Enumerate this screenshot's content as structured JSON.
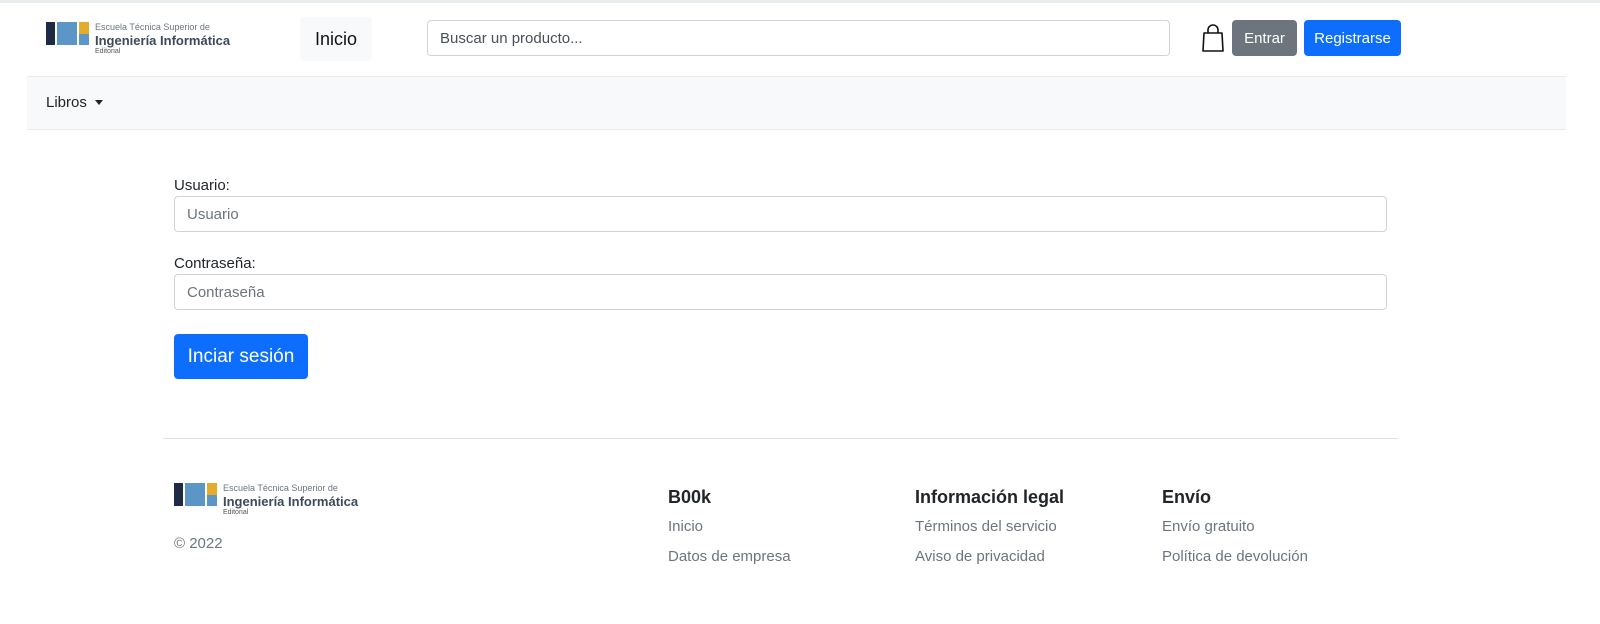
{
  "header": {
    "logo": {
      "line1": "Escuela Técnica Superior de",
      "line2": "Ingeniería Informática",
      "line3": "Editorial"
    },
    "home_link": "Inicio",
    "search_placeholder": "Buscar un producto...",
    "cart_icon": "shopping-bag-icon",
    "login_label": "Entrar",
    "register_label": "Registrarse"
  },
  "nav": {
    "books_dropdown": "Libros"
  },
  "form": {
    "user_label": "Usuario:",
    "user_placeholder": "Usuario",
    "password_label": "Contraseña:",
    "password_placeholder": "Contraseña",
    "submit_label": "Inciar sesión"
  },
  "footer": {
    "logo": {
      "line1": "Escuela Técnica Superior de",
      "line2": "Ingeniería Informática",
      "line3": "Editorial"
    },
    "copyright": "© 2022",
    "columns": [
      {
        "title": "B00k",
        "links": [
          "Inicio",
          "Datos de empresa"
        ]
      },
      {
        "title": "Información legal",
        "links": [
          "Términos del servicio",
          "Aviso de privacidad"
        ]
      },
      {
        "title": "Envío",
        "links": [
          "Envío gratuito",
          "Política de devolución"
        ]
      }
    ]
  },
  "colors": {
    "primary": "#0d6efd",
    "secondary": "#6c757d",
    "logo_navy": "#1f2a44",
    "logo_blue": "#5b96c6",
    "logo_yellow": "#e3ad2b"
  }
}
